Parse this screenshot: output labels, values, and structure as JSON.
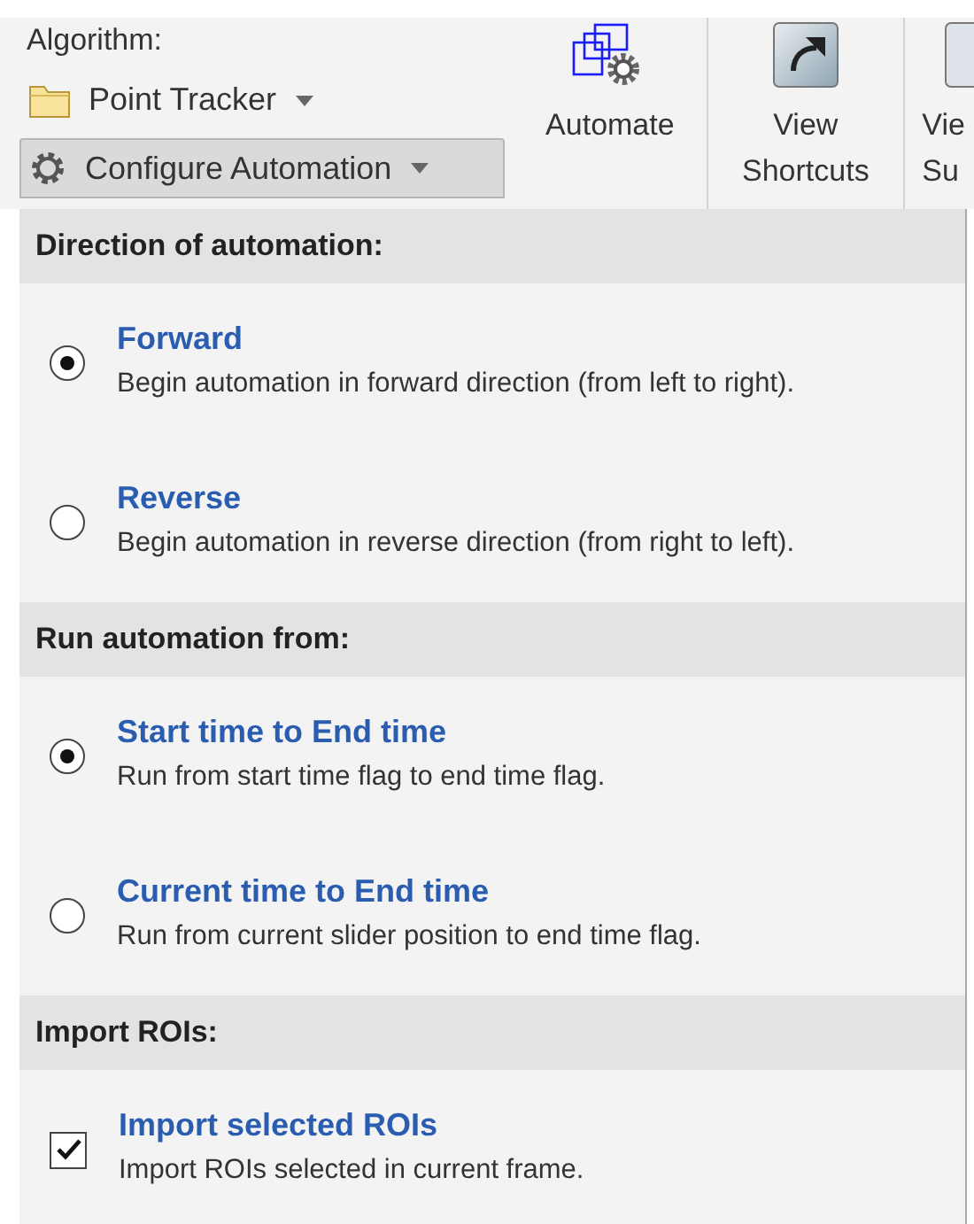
{
  "toolbar": {
    "algorithm_label": "Algorithm:",
    "algorithm": "Point Tracker",
    "configure_button": "Configure Automation",
    "buttons": [
      {
        "kind": "automate",
        "lines": [
          "Automate"
        ]
      },
      {
        "kind": "shortcut",
        "lines": [
          "View",
          "Shortcuts"
        ]
      },
      {
        "kind": "cut",
        "lines": [
          "Vie",
          "Su"
        ]
      }
    ]
  },
  "menu": {
    "sections": [
      {
        "title": "Direction of automation:",
        "items": [
          {
            "kind": "radio",
            "label": "Forward",
            "description": "Begin automation in forward direction (from left to right).",
            "selected": true
          },
          {
            "kind": "radio",
            "label": "Reverse",
            "description": "Begin automation in reverse direction (from right to left).",
            "selected": false
          }
        ]
      },
      {
        "title": "Run automation from:",
        "items": [
          {
            "kind": "radio",
            "label": "Start time to End time",
            "description": "Run from start time flag to end time flag.",
            "selected": true
          },
          {
            "kind": "radio",
            "label": "Current time to End time",
            "description": "Run from current slider position to end time flag.",
            "selected": false
          }
        ]
      },
      {
        "title": "Import ROIs:",
        "items": [
          {
            "kind": "checkbox",
            "label": "Import selected ROIs",
            "description": "Import ROIs selected in current frame.",
            "checked": true
          }
        ]
      }
    ]
  }
}
